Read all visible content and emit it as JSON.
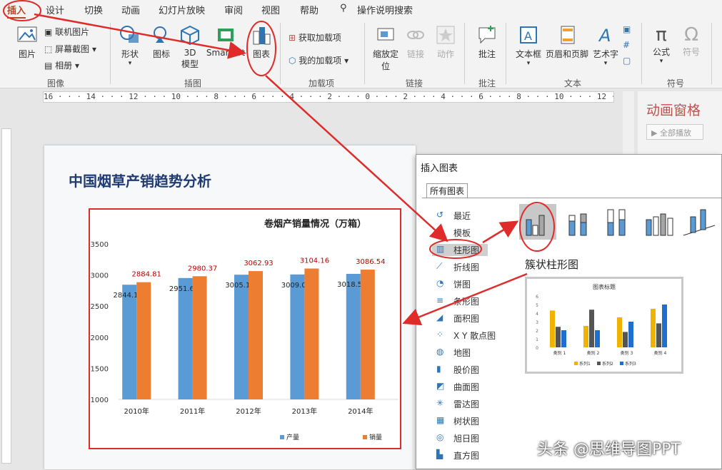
{
  "tabs": [
    "插入",
    "设计",
    "切换",
    "动画",
    "幻灯片放映",
    "审阅",
    "视图",
    "帮助"
  ],
  "search_label": "操作说明搜索",
  "ribbon": {
    "image_group": {
      "picture": "图片",
      "online_picture": "联机图片",
      "screenshot": "屏幕截图",
      "album": "相册",
      "group_label": "图像"
    },
    "illustration_group": {
      "shapes": "形状",
      "icons": "图标",
      "model3d_1": "3D",
      "model3d_2": "模型",
      "smartart": "SmartArt",
      "chart": "图表",
      "group_label": "插图"
    },
    "addins_group": {
      "get_addins": "获取加载项",
      "my_addins": "我的加载项",
      "group_label": "加载项"
    },
    "links_group": {
      "zoom_1": "缩放定",
      "zoom_2": "位",
      "link": "链接",
      "action": "动作",
      "group_label": "链接"
    },
    "comments_group": {
      "comment": "批注",
      "group_label": "批注"
    },
    "text_group": {
      "textbox": "文本框",
      "header_footer": "页眉和页脚",
      "wordart": "艺术字",
      "group_label": "文本"
    },
    "symbols_group": {
      "equation": "公式",
      "symbol": "符号",
      "group_label": "符号"
    }
  },
  "ruler_text": "16 · · · 14 · · · 12 · · · 10 · · · 8 · · · 6 · · · 4 · · · 2 · · · 0 · · · 2 · · · 4 · · · 6 · · · 8 · · · 10 · · · 12 · · · 14 · · · 16",
  "slide": {
    "title": "中国烟草产销趋势分析"
  },
  "chart_data": {
    "type": "bar",
    "title": "卷烟产销量情况（万箱）",
    "categories": [
      "2010年",
      "2011年",
      "2012年",
      "2013年",
      "2014年"
    ],
    "series": [
      {
        "name": "产量",
        "values": [
          2844.13,
          2951.66,
          3005.11,
          3009.04,
          3018.59
        ],
        "color": "#5b9bd5"
      },
      {
        "name": "销量",
        "values": [
          2884.81,
          2980.37,
          3062.93,
          3104.16,
          3086.54
        ],
        "color": "#ed7d31"
      }
    ],
    "yticks": [
      "3500",
      "3000",
      "2500",
      "2000",
      "1500",
      "1000"
    ],
    "ylim": [
      1000,
      3500
    ],
    "legend": "bottom"
  },
  "animation_pane": {
    "title": "动画窗格",
    "play_all": "全部播放"
  },
  "dialog": {
    "title": "插入图表",
    "tab": "所有图表",
    "categories": [
      "最近",
      "模板",
      "柱形图",
      "折线图",
      "饼图",
      "条形图",
      "面积图",
      "X Y 散点图",
      "地图",
      "股价图",
      "曲面图",
      "雷达图",
      "树状图",
      "旭日图",
      "直方图"
    ],
    "selected_category": "柱形图",
    "subtype_label": "簇状柱形图",
    "preview": {
      "title": "图表标题",
      "categories": [
        "类别 1",
        "类别 2",
        "类别 3",
        "类别 4"
      ],
      "series_names": [
        "系列1",
        "系列2",
        "系列3"
      ],
      "yticks": [
        "6",
        "5",
        "4",
        "3",
        "2",
        "1",
        "0"
      ],
      "values": [
        [
          4.3,
          2.5,
          3.5,
          4.5
        ],
        [
          2.4,
          4.4,
          1.8,
          2.8
        ],
        [
          2,
          2,
          3,
          5
        ]
      ],
      "colors": [
        "#f0b400",
        "#555555",
        "#1f6fd1"
      ]
    }
  },
  "watermark": "头条 @思维导图PPT",
  "colors": {
    "accent": "#b7472a",
    "annotation": "#e02b2b"
  }
}
